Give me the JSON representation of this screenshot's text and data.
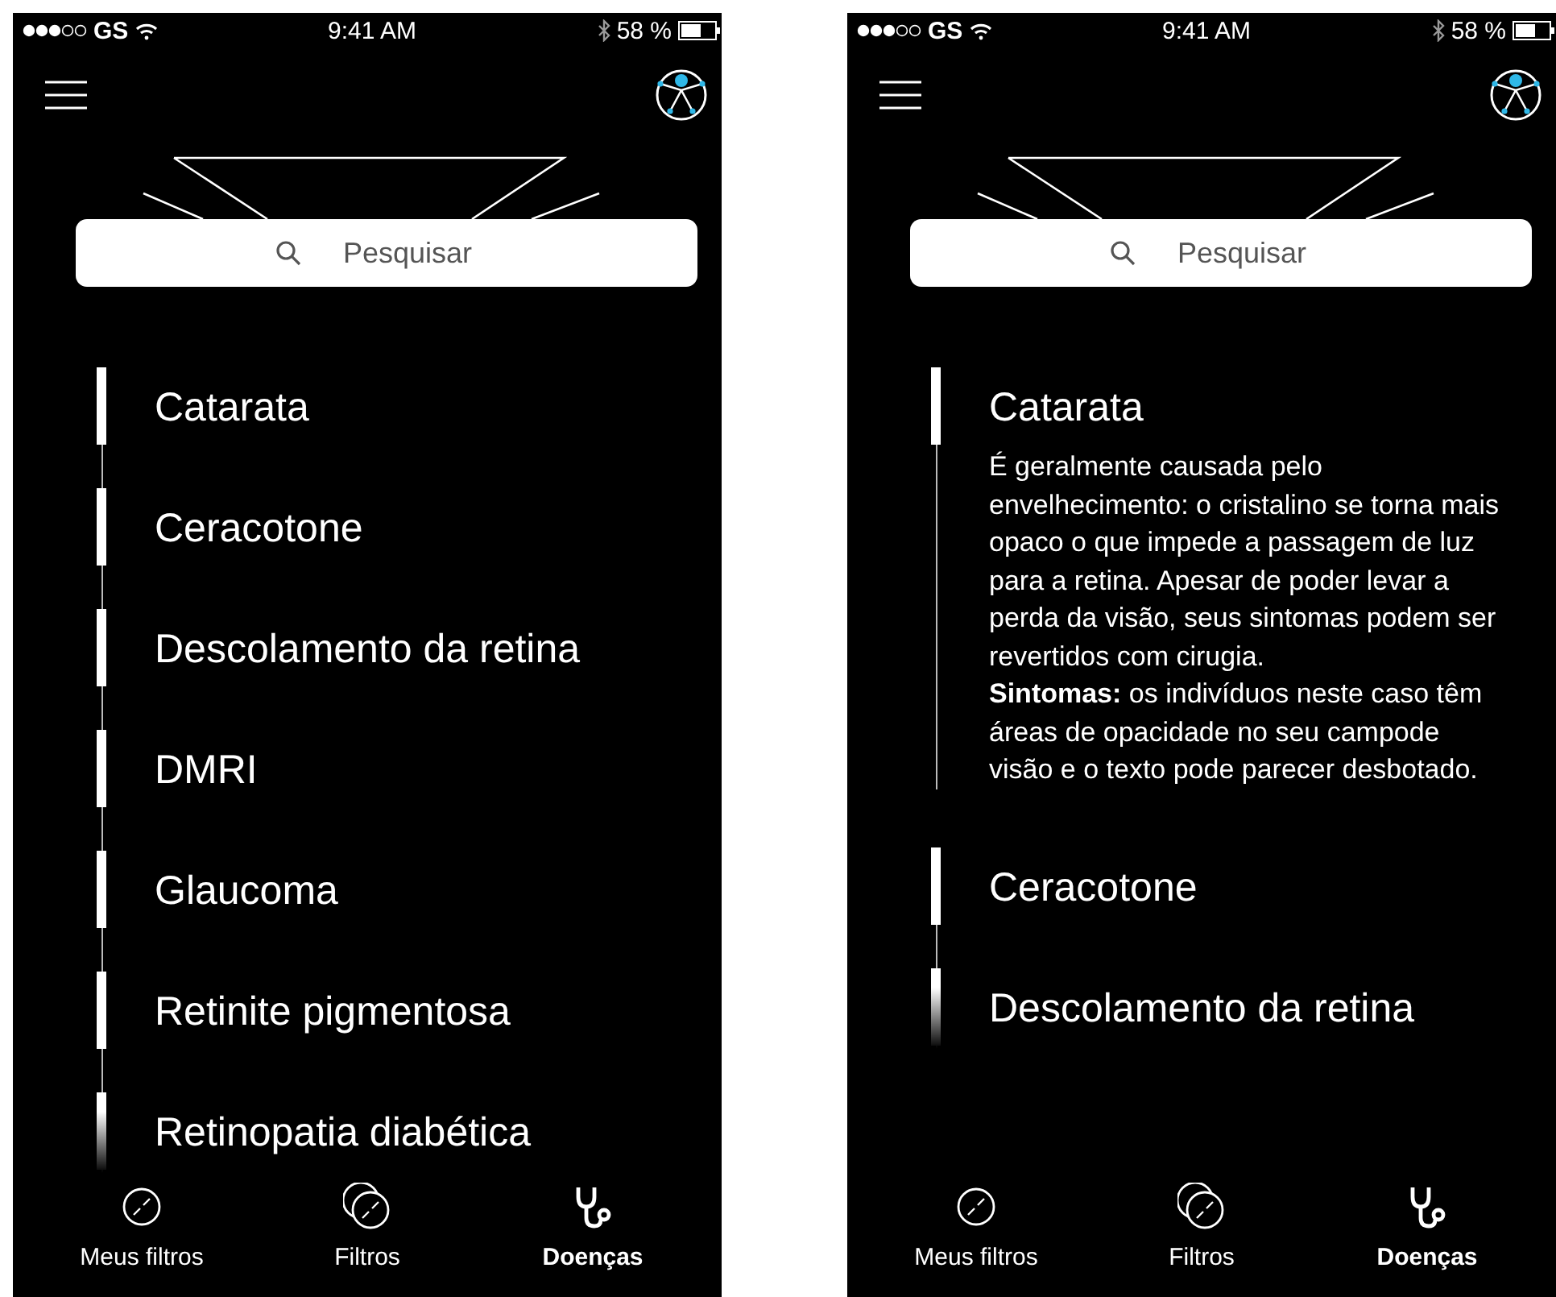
{
  "screens": [
    {
      "status_bar": {
        "carrier": "GS",
        "time": "9:41 AM",
        "battery": "58 %"
      },
      "search": {
        "placeholder": "Pesquisar"
      },
      "diseases": [
        {
          "name": "Catarata"
        },
        {
          "name": "Ceracotone"
        },
        {
          "name": "Descolamento da retina"
        },
        {
          "name": "DMRI"
        },
        {
          "name": "Glaucoma"
        },
        {
          "name": "Retinite pigmentosa"
        },
        {
          "name": "Retinopatia diabética"
        }
      ],
      "tabs": [
        {
          "label": "Meus filtros",
          "selected": false
        },
        {
          "label": "Filtros",
          "selected": false
        },
        {
          "label": "Doenças",
          "selected": true
        }
      ]
    },
    {
      "status_bar": {
        "carrier": "GS",
        "time": "9:41 AM",
        "battery": "58 %"
      },
      "search": {
        "placeholder": "Pesquisar"
      },
      "diseases": [
        {
          "name": "Catarata",
          "description": [
            "É geralmente causada pelo envelhecimento: o cristalino se torna mais opaco o que impede a passagem de luz para a retina. Apesar de poder levar a perda da visão, seus sintomas podem ser revertidos com cirugia.",
            "**Sintomas:** os indivíduos neste caso têm áreas de opacidade no seu campode visão e o texto pode parecer desbotado."
          ]
        },
        {
          "name": "Ceracotone"
        },
        {
          "name": "Descolamento da retina"
        }
      ],
      "tabs": [
        {
          "label": "Meus filtros",
          "selected": false
        },
        {
          "label": "Filtros",
          "selected": false
        },
        {
          "label": "Doenças",
          "selected": true
        }
      ]
    }
  ]
}
